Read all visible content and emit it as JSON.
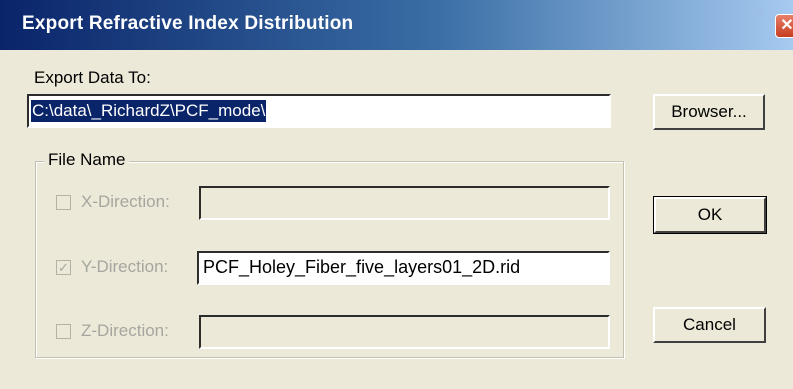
{
  "dialog": {
    "title": "Export Refractive Index Distribution",
    "close_glyph": "✕"
  },
  "export": {
    "label": "Export Data To:",
    "path_value": "C:\\data\\_RichardZ\\PCF_mode\\"
  },
  "buttons": {
    "browse": "Browser...",
    "ok": "OK",
    "cancel": "Cancel"
  },
  "file_name_group": {
    "title": "File Name",
    "x": {
      "label": "X-Direction:",
      "checked": false,
      "value": ""
    },
    "y": {
      "label": "Y-Direction:",
      "checked": true,
      "value": "PCF_Holey_Fiber_five_layers01_2D.rid",
      "check_glyph": "✓"
    },
    "z": {
      "label": "Z-Direction:",
      "checked": false,
      "value": ""
    }
  },
  "colors": {
    "titlebar_start": "#0a246a",
    "titlebar_end": "#a6caf0",
    "dialog_bg": "#ece9d8",
    "selection_bg": "#0a246a"
  },
  "icons": [
    "close-icon",
    "checkbox-icon"
  ]
}
